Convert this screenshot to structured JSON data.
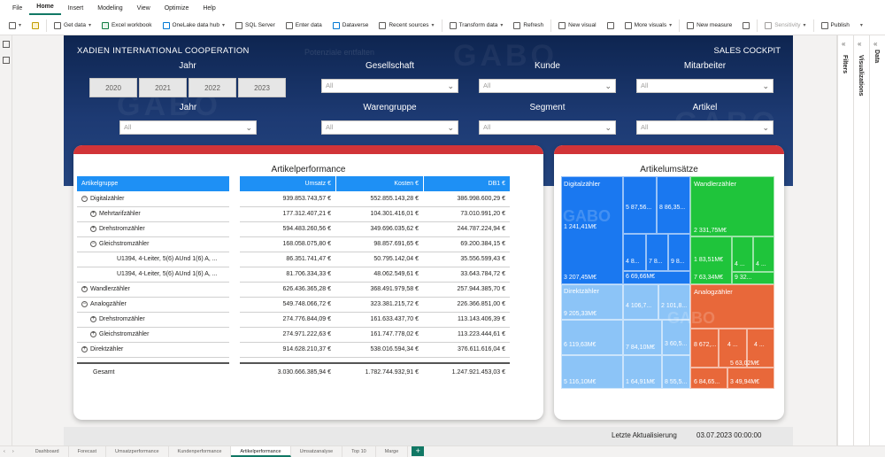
{
  "menu": [
    "File",
    "Home",
    "Insert",
    "Modeling",
    "View",
    "Optimize",
    "Help"
  ],
  "ribbon": {
    "get_data": "Get data",
    "excel": "Excel workbook",
    "onelake": "OneLake data hub",
    "sql": "SQL Server",
    "enter_data": "Enter data",
    "dataverse": "Dataverse",
    "recent": "Recent sources",
    "transform": "Transform data",
    "refresh": "Refresh",
    "new_visual": "New visual",
    "more_visuals": "More visuals",
    "new_measure": "New measure",
    "sensitivity": "Sensitivity",
    "publish": "Publish"
  },
  "panes": {
    "filters": "Filters",
    "visualizations": "Visualizations",
    "data": "Data"
  },
  "header": {
    "company": "XADIEN INTERNATIONAL COOPERATION",
    "cockpit": "SALES COCKPIT",
    "wm_text": "Potenziale entfalten"
  },
  "filters": {
    "jahr1": "Jahr",
    "gesellschaft": "Gesellschaft",
    "kunde": "Kunde",
    "mitarbeiter": "Mitarbeiter",
    "jahr2": "Jahr",
    "warengruppe": "Warengruppe",
    "segment": "Segment",
    "artikel": "Artikel",
    "all": "All",
    "years": [
      "2020",
      "2021",
      "2022",
      "2023"
    ]
  },
  "perf": {
    "title": "Artikelperformance",
    "headers": [
      "Artikelgruppe",
      "Umsatz €",
      "Kosten €",
      "DB1 €"
    ],
    "rows": [
      [
        "Digitalzähler",
        "939.853.743,57 €",
        "552.855.143,28 €",
        "386.998.600,29 €"
      ],
      [
        "Mehrtarifzähler",
        "177.312.407,21 €",
        "104.301.416,01 €",
        "73.010.991,20 €"
      ],
      [
        "Drehstromzähler",
        "594.483.260,56 €",
        "349.696.035,62 €",
        "244.787.224,94 €"
      ],
      [
        "Gleichstromzähler",
        "168.058.075,80 €",
        "98.857.691,65 €",
        "69.200.384,15 €"
      ],
      [
        "U1394, 4-Leiter, 5(6) AUnd 1(6) A, ...",
        "86.351.741,47 €",
        "50.795.142,04 €",
        "35.556.599,43 €"
      ],
      [
        "U1394, 4-Leiter, 5(6) AUnd 1(6) A, ...",
        "81.706.334,33 €",
        "48.062.549,61 €",
        "33.643.784,72 €"
      ],
      [
        "Wandlerzähler",
        "626.436.365,28 €",
        "368.491.979,58 €",
        "257.944.385,70 €"
      ],
      [
        "Analogzähler",
        "549.748.066,72 €",
        "323.381.215,72 €",
        "226.366.851,00 €"
      ],
      [
        "Drehstromzähler",
        "274.776.844,09 €",
        "161.633.437,70 €",
        "113.143.406,39 €"
      ],
      [
        "Gleichstromzähler",
        "274.971.222,63 €",
        "161.747.778,02 €",
        "113.223.444,61 €"
      ],
      [
        "Direktzähler",
        "914.628.210,37 €",
        "538.016.594,34 €",
        "376.611.616,04 €"
      ]
    ],
    "total": [
      "Gesamt",
      "3.030.666.385,94 €",
      "1.782.744.932,91 €",
      "1.247.921.453,03 €"
    ]
  },
  "umsatz": {
    "title": "Artikelumsätze",
    "groups": {
      "digital": "Digitalzähler",
      "wandler": "Wandlerzähler",
      "direkt": "Direktzähler",
      "analog": "Analogzähler"
    },
    "labels": {
      "d1": "1 241,41M€",
      "d2": "5 87,56...",
      "d3": "8 86,35...",
      "d4": "3 207,45M€",
      "d5": "4 8...",
      "d6": "7 8...",
      "d7": "9 8...",
      "d8": "6 69,66M€",
      "w1": "2 331,75M€",
      "w2": "1 83,51M€",
      "w3": "4 ...",
      "w4": "4 ...",
      "w5": "7 63,34M€",
      "w6": "9 32...",
      "r1": "9 205,33M€",
      "r2": "4 106,7...",
      "r3": "2 101,8...",
      "r4": "6 119,63M€",
      "r5": "7 84,10M€",
      "r6": "3 60,5...",
      "r7": "5 116,10M€",
      "r8": "1 64,91M€",
      "r9": "8 55,5...",
      "a1": "8 672,...",
      "a2": "4 ...",
      "a3": "4 ...",
      "a4": "5 63,02M€",
      "a5": "6 84,65...",
      "a6": "3 49,94M€"
    }
  },
  "footer": {
    "label": "Letzte Aktualisierung",
    "value": "03.07.2023 00:00:00"
  },
  "tabs": [
    "Dashboard",
    "Forecast",
    "Umsatzperformance",
    "Kundenperformance",
    "Artikelperformance",
    "Umsatzanalyse",
    "Top 10",
    "Marge"
  ],
  "colors": {
    "accent": "#1e90f5",
    "red": "#d13438",
    "digital": "#1a78f0",
    "wandler": "#1fc43b",
    "direkt": "#8cc4f7",
    "analog": "#e8683a",
    "pbi_green": "#117865"
  }
}
